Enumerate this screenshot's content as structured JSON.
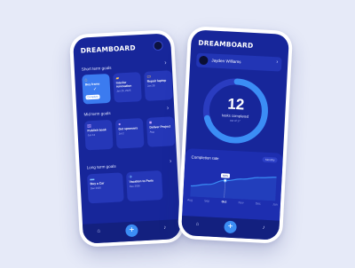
{
  "colors": {
    "background": "#e6eaf8",
    "screen": "#17269a",
    "card": "#2537b8",
    "accent": "#3b7bf0",
    "ring_track": "#2a3cc0",
    "ring_fill": "#3b8df5"
  },
  "left_screen": {
    "logo": "DREAMBOARD",
    "short_term": {
      "title": "Short term goals",
      "cards": [
        {
          "icon": "home-icon",
          "title": "Buy frame",
          "status": "Complete"
        },
        {
          "icon": "sofa-icon",
          "title": "Interior renovation",
          "date": "Jan 26, 2025"
        },
        {
          "icon": "laptop-icon",
          "title": "Repair laptop",
          "date": "Jan 28"
        }
      ]
    },
    "mid_term": {
      "title": "Mid term goals",
      "cards": [
        {
          "icon": "book-icon",
          "title": "Publish book",
          "date": "Jun 12"
        },
        {
          "icon": "people-icon",
          "title": "Get sponsors",
          "date": "Jul 2"
        },
        {
          "icon": "project-icon",
          "title": "Deliver Project",
          "date": "Aug"
        }
      ]
    },
    "long_term": {
      "title": "Long term goals",
      "cards": [
        {
          "icon": "car-icon",
          "title": "Buy a Car",
          "date": "Dec 2026"
        },
        {
          "icon": "plane-icon",
          "title": "Vacation to Paris",
          "date": "Dec 2026"
        }
      ]
    },
    "nav": {
      "home": "⌂",
      "add": "+",
      "bell": "♪"
    }
  },
  "right_screen": {
    "logo": "DREAMBOARD",
    "user": {
      "name": "Jayden Williams",
      "chevron": "›"
    },
    "tasks": {
      "completed": "12",
      "label": "tasks completed",
      "sub": "out of 17",
      "progress": 0.7
    },
    "chart_data": {
      "type": "line",
      "title": "Completion rate",
      "period": "Monthly",
      "categories": [
        "Aug",
        "Sep",
        "Oct",
        "Nov",
        "Dec",
        "Jan"
      ],
      "values": [
        3,
        4,
        6,
        7,
        8,
        8.5
      ],
      "selected": "Oct",
      "selected_label": "60%",
      "ylim": [
        0,
        12
      ]
    },
    "nav": {
      "home": "⌂",
      "add": "+",
      "bell": "♪"
    }
  }
}
